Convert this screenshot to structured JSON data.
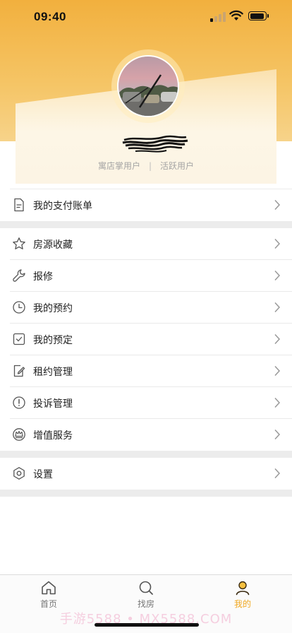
{
  "status_bar": {
    "time": "09:40"
  },
  "profile": {
    "tags": [
      "寓店掌用户",
      "活跃用户"
    ],
    "separator": "|"
  },
  "menu": {
    "group1": [
      {
        "label": "我的支付账单",
        "icon": "bill-icon"
      }
    ],
    "group2": [
      {
        "label": "房源收藏",
        "icon": "star-icon"
      },
      {
        "label": "报修",
        "icon": "wrench-icon"
      },
      {
        "label": "我的预约",
        "icon": "clock-icon"
      },
      {
        "label": "我的预定",
        "icon": "checkbox-icon"
      },
      {
        "label": "租约管理",
        "icon": "edit-document-icon"
      },
      {
        "label": "投诉管理",
        "icon": "exclamation-icon"
      },
      {
        "label": "增值服务",
        "icon": "crown-icon"
      }
    ],
    "group3": [
      {
        "label": "设置",
        "icon": "hexagon-settings-icon"
      }
    ]
  },
  "tabbar": {
    "tabs": [
      {
        "label": "首页",
        "icon": "home-icon"
      },
      {
        "label": "找房",
        "icon": "search-icon"
      },
      {
        "label": "我的",
        "icon": "user-icon"
      }
    ],
    "active_index": 2
  },
  "watermark": "手游5588 • MX5588.COM",
  "colors": {
    "accent": "#f0a821",
    "header": "#f2b03e"
  }
}
